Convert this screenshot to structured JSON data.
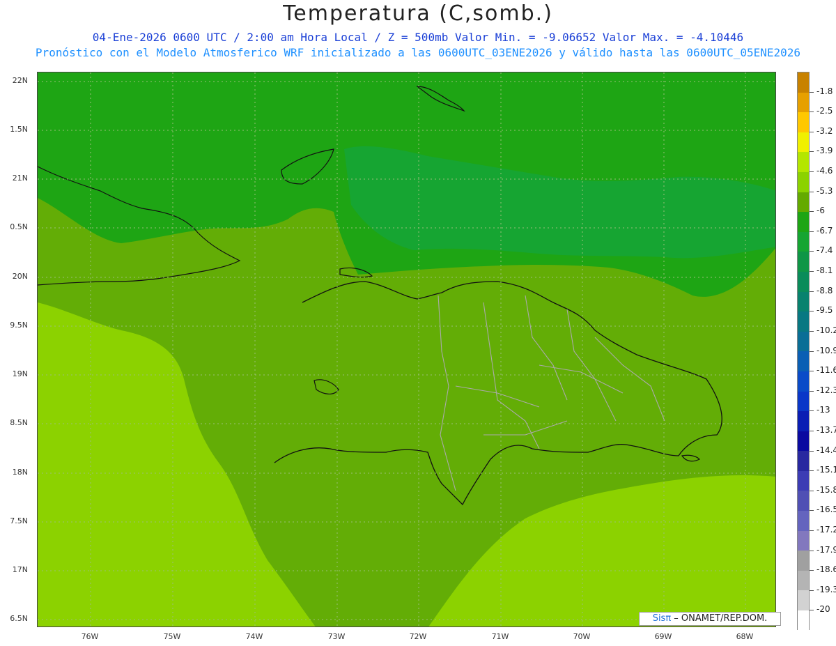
{
  "header": {
    "title": "Temperatura (C,somb.)",
    "line1": "04-Ene-2026  0600 UTC / 2:00 am Hora Local / Z = 500mb  Valor Min. = -9.06652  Valor Max. = -4.10446",
    "line2": "Pronóstico con el Modelo Atmosferico WRF inicializado a las 0600UTC_03ENE2026 y válido hasta las  0600UTC_05ENE2026"
  },
  "axes": {
    "lat_labels": [
      "22N",
      "1.5N",
      "21N",
      "0.5N",
      "20N",
      "9.5N",
      "19N",
      "8.5N",
      "18N",
      "7.5N",
      "17N",
      "6.5N"
    ],
    "lon_labels": [
      "76W",
      "75W",
      "74W",
      "73W",
      "72W",
      "71W",
      "70W",
      "69W",
      "68W"
    ]
  },
  "colorbar": {
    "labels": [
      "-1.8",
      "-2.5",
      "-3.2",
      "-3.9",
      "-4.6",
      "-5.3",
      "-6",
      "-6.7",
      "-7.4",
      "-8.1",
      "-8.8",
      "-9.5",
      "-10.2",
      "-10.9",
      "-11.6",
      "-12.3",
      "-13",
      "-13.7",
      "-14.4",
      "-15.1",
      "-15.8",
      "-16.5",
      "-17.2",
      "-17.9",
      "-18.6",
      "-19.3",
      "-20"
    ],
    "colors": [
      "#c88200",
      "#e6a000",
      "#ffc800",
      "#f0f000",
      "#b4e600",
      "#8cd200",
      "#64aa00",
      "#1ea514",
      "#16a532",
      "#0f9646",
      "#0a8c5a",
      "#08826e",
      "#087882",
      "#0a6e96",
      "#0a5fb4",
      "#0a4bc8",
      "#0a37c8",
      "#0a1eb4",
      "#0a0aa0",
      "#2828a0",
      "#3c3cb4",
      "#5050b4",
      "#6464be",
      "#8278be",
      "#a0a0a0",
      "#b4b4b4",
      "#d2d2d2",
      "#ffffff"
    ]
  },
  "credit": {
    "brand": "Sisπ",
    "text": " – ONAMET/REP.DOM."
  }
}
